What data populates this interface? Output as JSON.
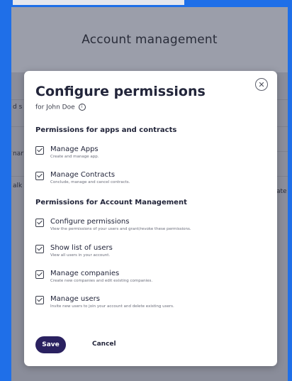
{
  "app": {
    "title": "Account management",
    "bg_fragments": [
      "d s",
      "nar",
      "alk",
      "ate"
    ]
  },
  "modal": {
    "title": "Configure permissions",
    "subtitle": "for John Doe",
    "close_icon": "close-icon",
    "sections": [
      {
        "heading": "Permissions for apps and contracts",
        "items": [
          {
            "label": "Manage Apps",
            "desc": "Create and manage app.",
            "checked": true
          },
          {
            "label": "Manage Contracts",
            "desc": "Conclude, manage and cancel contracts.",
            "checked": true
          }
        ]
      },
      {
        "heading": "Permissions for Account Management",
        "items": [
          {
            "label": "Configure permissions",
            "desc": "View the permissions of your users and grant/revoke these permissions.",
            "checked": true
          },
          {
            "label": "Show list of users",
            "desc": "View all users in your account.",
            "checked": true
          },
          {
            "label": "Manage companies",
            "desc": "Create new companies and edit existing companies.",
            "checked": true
          },
          {
            "label": "Manage users",
            "desc": "Invite new users to join your account and delete existing users.",
            "checked": true
          }
        ]
      }
    ],
    "save_label": "Save",
    "cancel_label": "Cancel"
  }
}
